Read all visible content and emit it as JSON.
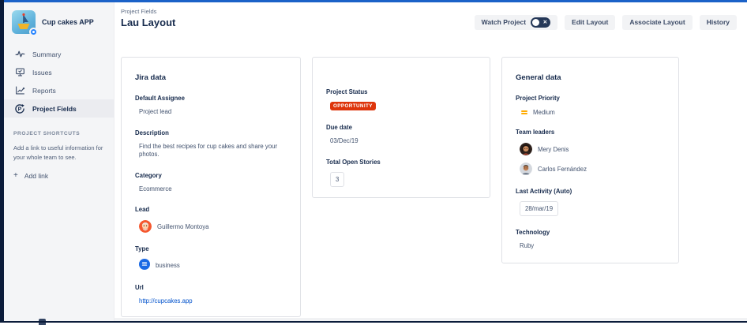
{
  "window": {
    "accent_line_color": "#1B62C8",
    "frame_color": "#0B1C3A"
  },
  "sidebar": {
    "app_name": "Cup cakes APP",
    "app_icon": "cupcake-app-icon",
    "nav": [
      {
        "label": "Summary",
        "icon": "pulse-icon",
        "selected": false
      },
      {
        "label": "Issues",
        "icon": "monitor-icon",
        "selected": false
      },
      {
        "label": "Reports",
        "icon": "chart-icon",
        "selected": false
      },
      {
        "label": "Project Fields",
        "icon": "project-fields-icon",
        "selected": true
      }
    ],
    "shortcuts_heading": "PROJECT SHORTCUTS",
    "shortcuts_description": "Add a link to useful information for your whole team to see.",
    "add_link_label": "Add link",
    "add_link_icon": "plus-icon"
  },
  "header": {
    "breadcrumb": "Project Fields",
    "title": "Lau Layout",
    "buttons": {
      "watch": "Watch Project",
      "edit": "Edit Layout",
      "associate": "Associate Layout",
      "history": "History"
    },
    "watch_toggle_state": "off"
  },
  "cards": {
    "jira": {
      "title": "Jira data",
      "default_assignee_label": "Default Assignee",
      "default_assignee_value": "Project lead",
      "description_label": "Description",
      "description_value": "Find the best recipes for cup cakes and share your photos.",
      "category_label": "Category",
      "category_value": "Ecommerce",
      "lead_label": "Lead",
      "lead_value": "Guillermo Montoya",
      "lead_avatar": "guillermo-avatar",
      "type_label": "Type",
      "type_value": "business",
      "type_icon": "business-project-icon",
      "url_label": "Url",
      "url_value": "http://cupcakes.app"
    },
    "status": {
      "project_status_label": "Project Status",
      "project_status_value": "OPPORTUNITY",
      "project_status_color": "#DE350B",
      "due_date_label": "Due date",
      "due_date_value": "03/Dec/19",
      "total_open_label": "Total Open Stories",
      "total_open_value": "3"
    },
    "general": {
      "title": "General data",
      "priority_label": "Project Priority",
      "priority_value": "Medium",
      "priority_icon": "medium-priority-icon",
      "priority_color": "#FFAB00",
      "team_label": "Team leaders",
      "leaders": [
        {
          "name": "Mery Denis",
          "avatar": "mery-avatar"
        },
        {
          "name": "Carlos Fernández",
          "avatar": "carlos-avatar"
        }
      ],
      "last_activity_label": "Last Activity (Auto)",
      "last_activity_value": "28/mar/19",
      "technology_label": "Technology",
      "technology_value": "Ruby"
    }
  },
  "colors": {
    "sidebar_bg": "#F4F5F7",
    "selected_nav_bg": "#EBECF0",
    "card_border": "#DFE1E6",
    "link": "#0052CC",
    "badge_bg": "#DE350B",
    "priority": "#FFAB00",
    "toggle_bg": "#253858"
  }
}
